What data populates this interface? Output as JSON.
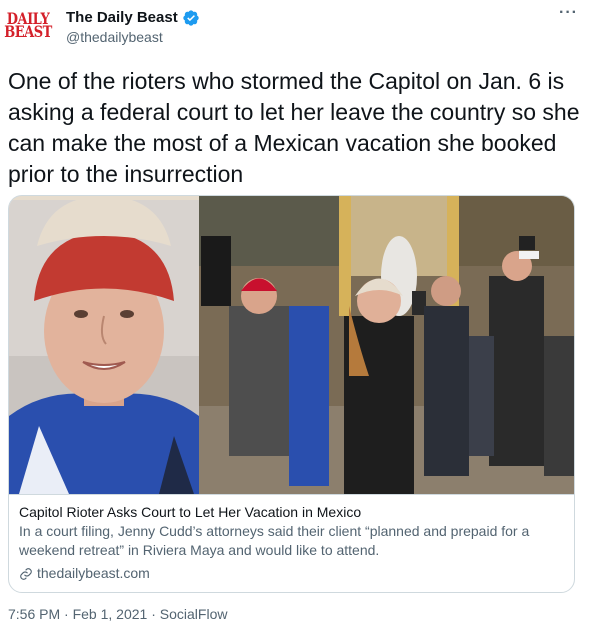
{
  "tweet": {
    "author_name": "The Daily Beast",
    "author_handle": "@thedailybeast",
    "avatar_lines": [
      "DAILY",
      "BEAST"
    ],
    "verified": true,
    "more_label": "···",
    "text": "One of the rioters who stormed the Capitol on Jan. 6 is asking a federal court to let her leave the country so she can make the most of a Mexican vacation she booked prior to the insurrection"
  },
  "card": {
    "title": "Capitol Rioter Asks Court to Let Her Vacation in Mexico",
    "description": "In a court filing, Jenny Cudd’s attorneys said their client “planned and prepaid for a weekend retreat” in Riviera Maya and would like to attend.",
    "domain": "thedailybeast.com",
    "domain_icon": "link-icon"
  },
  "meta": {
    "time": "7:56 PM",
    "date": "Feb 1, 2021",
    "source": "SocialFlow",
    "separator": "·"
  },
  "colors": {
    "brand_red": "#d4202a",
    "verified_blue": "#1d9bf0",
    "secondary_text": "#536471",
    "border": "#cfd9de"
  }
}
